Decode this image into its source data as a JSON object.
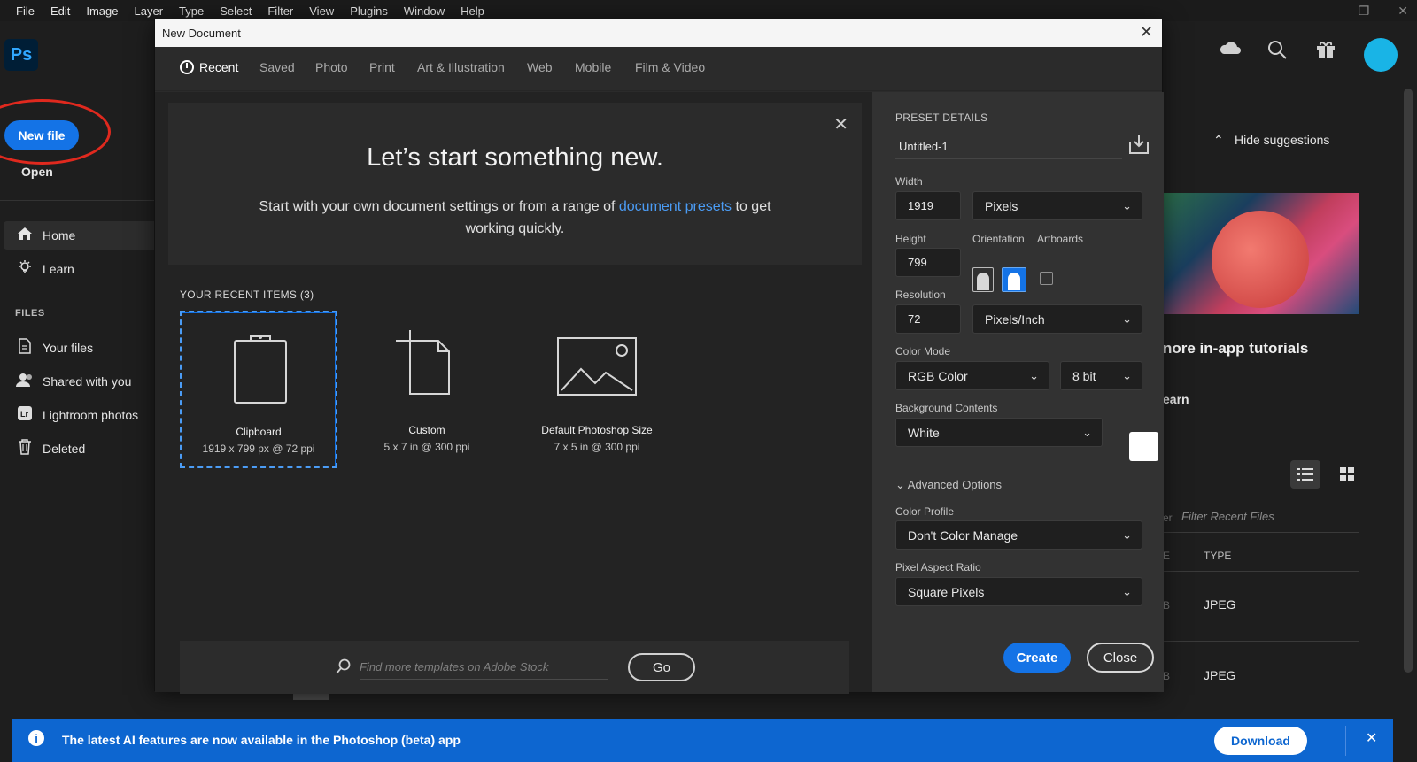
{
  "menu": [
    "File",
    "Edit",
    "Image",
    "Layer",
    "Type",
    "Select",
    "Filter",
    "View",
    "Plugins",
    "Window",
    "Help"
  ],
  "window_controls": {
    "minimize": "—",
    "restore": "❐",
    "close": "✕"
  },
  "app": {
    "logo": "Ps",
    "new_file": "New file",
    "open": "Open",
    "nav": {
      "home": "Home",
      "learn": "Learn"
    },
    "files_label": "FILES",
    "files": {
      "your_files": "Your files",
      "shared": "Shared with you",
      "lightroom": "Lightroom photos",
      "deleted": "Deleted"
    },
    "hide_suggestions": "Hide suggestions",
    "more_tutorials": "nore in-app tutorials",
    "learn_partial": "earn",
    "filter_placeholder": "Filter Recent Files",
    "filter_prefix": "er",
    "type_header": "TYPE",
    "type_header_prefix": "E",
    "file_rows": [
      {
        "prefix": "B",
        "type": "JPEG"
      },
      {
        "prefix": "B",
        "type": "JPEG"
      }
    ]
  },
  "dialog": {
    "title": "New Document",
    "tabs": [
      "Recent",
      "Saved",
      "Photo",
      "Print",
      "Art & Illustration",
      "Web",
      "Mobile",
      "Film & Video"
    ],
    "hero": {
      "title": "Let’s start something new.",
      "text_before": "Start with your own document settings or from a range of ",
      "link": "document presets",
      "text_after": " to get working quickly."
    },
    "recent_label": "YOUR RECENT ITEMS  (3)",
    "recent_items": [
      {
        "name": "Clipboard",
        "detail": "1919 x 799 px @ 72 ppi"
      },
      {
        "name": "Custom",
        "detail": "5 x 7 in @ 300 ppi"
      },
      {
        "name": "Default Photoshop Size",
        "detail": "7 x 5 in @ 300 ppi"
      }
    ],
    "search_placeholder": "Find more templates on Adobe Stock",
    "go": "Go",
    "preset": {
      "header": "PRESET DETAILS",
      "name": "Untitled-1",
      "width_label": "Width",
      "width": "1919",
      "width_unit": "Pixels",
      "height_label": "Height",
      "height": "799",
      "orientation_label": "Orientation",
      "artboards_label": "Artboards",
      "resolution_label": "Resolution",
      "resolution": "72",
      "resolution_unit": "Pixels/Inch",
      "color_mode_label": "Color Mode",
      "color_mode": "RGB Color",
      "bit_depth": "8 bit",
      "background_label": "Background Contents",
      "background": "White",
      "advanced": "Advanced Options",
      "color_profile_label": "Color Profile",
      "color_profile": "Don't Color Manage",
      "pixel_aspect_label": "Pixel Aspect Ratio",
      "pixel_aspect": "Square Pixels",
      "create": "Create",
      "close": "Close"
    }
  },
  "banner": {
    "text": "The latest AI features are now available in the Photoshop (beta) app",
    "download": "Download"
  },
  "colors": {
    "accent": "#1473e6",
    "banner": "#0d66d0",
    "annotation": "#e0291e"
  }
}
